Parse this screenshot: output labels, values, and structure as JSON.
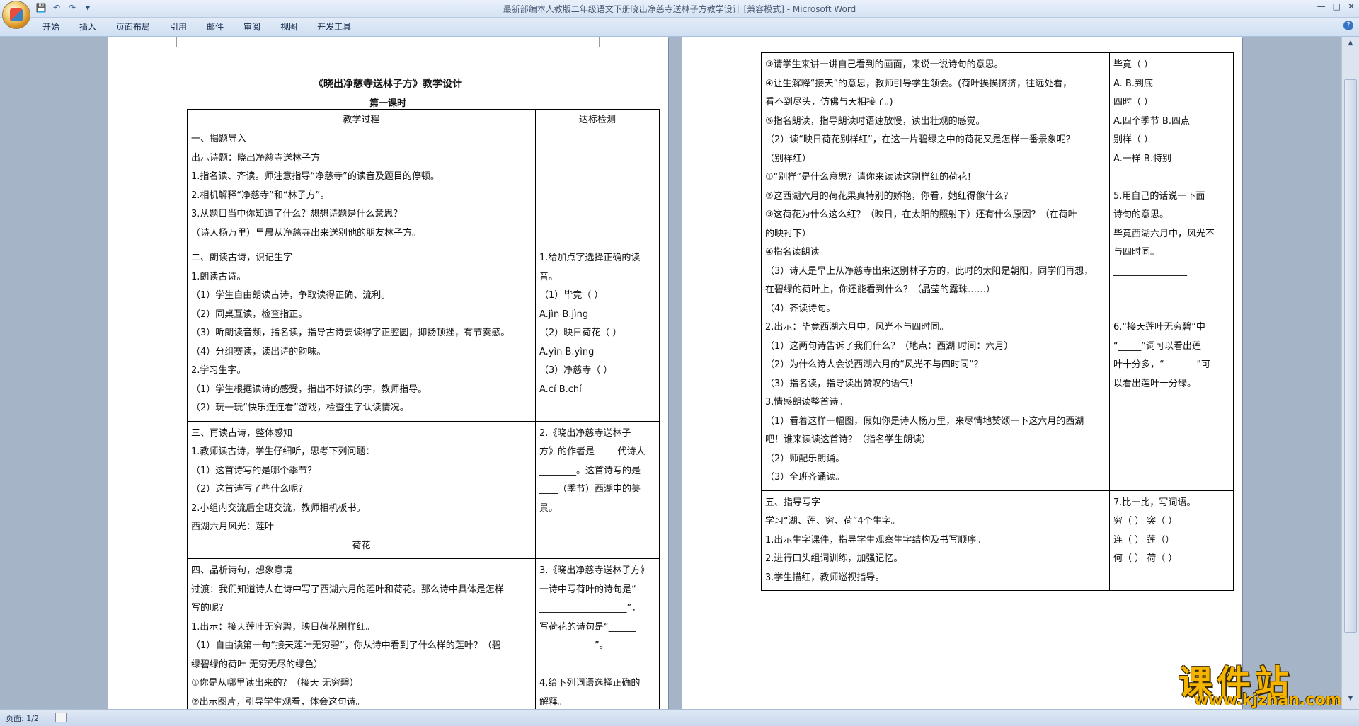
{
  "window": {
    "title": "最新部编本人教版二年级语文下册晓出净慈寺送林子方教学设计 [兼容模式] - Microsoft Word",
    "minimize": "—",
    "maximize": "□",
    "close": "✕"
  },
  "ribbon": {
    "tabs": [
      "开始",
      "插入",
      "页面布局",
      "引用",
      "邮件",
      "审阅",
      "视图",
      "开发工具"
    ],
    "help": "?"
  },
  "document": {
    "title": "《晓出净慈寺送林子方》教学设计",
    "subtitle": "第一课时",
    "table_headers": [
      "教学过程",
      "达标检测"
    ],
    "page1_rows": [
      {
        "left": [
          "一、揭题导入",
          "出示诗题：晓出净慈寺送林子方",
          "1.指名读、齐读。师注意指导“净慈寺”的读音及题目的停顿。",
          "2.相机解释“净慈寺”和“林子方”。",
          "3.从题目当中你知道了什么？想想诗题是什么意思？",
          "（诗人杨万里）早晨从净慈寺出来送别他的朋友林子方。"
        ],
        "right": [
          ""
        ]
      },
      {
        "left": [
          "二、朗读古诗，识记生字",
          "1.朗读古诗。",
          "（1）学生自由朗读古诗，争取读得正确、流利。",
          "（2）同桌互读，检查指正。",
          "（3）听朗读音频，指名读，指导古诗要读得字正腔圆，抑扬顿挫，有节奏感。",
          "（4）分组赛读，读出诗的韵味。",
          "2.学习生字。",
          "（1）学生根据读诗的感受，指出不好读的字，教师指导。",
          "（2）玩一玩“快乐连连看”游戏，检查生字认读情况。"
        ],
        "right": [
          "1.给加点字选择正确的读",
          "音。",
          "（1）毕竟（ ）",
          "A.jìn  B.jìng",
          "（2）映日荷花（ ）",
          "A.yìn  B.yìng",
          "（3）净慈寺（ ）",
          "A.cí  B.chí"
        ]
      },
      {
        "left": [
          "三、再读古诗，整体感知",
          "1.教师读古诗，学生仔细听，思考下列问题：",
          "（1）这首诗写的是哪个季节？",
          "（2）这首诗写了些什么呢?",
          "2.小组内交流后全班交流，教师相机板书。",
          "   西湖六月风光：莲叶",
          "荷花"
        ],
        "right": [
          "2.《晓出净慈寺送林子",
          "方》的作者是_____代诗人",
          "________。这首诗写的是",
          "____（季节）西湖中的美",
          "景。",
          ""
        ]
      },
      {
        "left": [
          "四、品析诗句，想象意境",
          "过渡：我们知道诗人在诗中写了西湖六月的莲叶和荷花。那么诗中具体是怎样",
          "写的呢？",
          "1.出示：接天莲叶无穷碧，映日荷花别样红。",
          "（1）自由读第一句“接天莲叶无穷碧”，你从诗中看到了什么样的莲叶？（碧",
          "绿碧绿的荷叶    无穷无尽的绿色）",
          "①你是从哪里读出来的？（接天    无穷碧）",
          "②出示图片，引导学生观看，体会这句诗。"
        ],
        "right": [
          "3.《晓出净慈寺送林子方》",
          "一诗中写荷叶的诗句是“_",
          "___________________”，",
          "写荷花的诗句是“______",
          "____________”。",
          "",
          "4.给下列词语选择正确的",
          "解释。"
        ]
      }
    ],
    "page2_rows": [
      {
        "left": [
          "③请学生来讲一讲自己看到的画面，来说一说诗句的意思。",
          "④让生解释“接天”的意思，教师引导学生领会。(荷叶挨挨挤挤，往远处看，",
          "看不到尽头，仿佛与天相接了。)",
          "⑤指名朗读，指导朗读时语速放慢，读出壮观的感觉。",
          "（2）读“映日荷花别样红”，在这一片碧绿之中的荷花又是怎样一番景象呢？",
          "（别样红）",
          "①“别样”是什么意思？请你来读读这别样红的荷花！",
          "②这西湖六月的荷花果真特别的娇艳，你看，她红得像什么？",
          "③这荷花为什么这么红？（映日，在太阳的照射下）还有什么原因？（在荷叶",
          "的映衬下）",
          "   ④指名读朗读。",
          "（3）诗人是早上从净慈寺出来送别林子方的，此时的太阳是朝阳，同学们再想，",
          "在碧绿的荷叶上，你还能看到什么？（晶莹的露珠……）",
          "（4）齐读诗句。",
          "2.出示：毕竟西湖六月中，风光不与四时同。",
          "（1）这两句诗告诉了我们什么？（地点：西湖    时间：六月）",
          "（2）为什么诗人会说西湖六月的“风光不与四时同”？",
          "（3）指名读，指导读出赞叹的语气！",
          "3.情感朗读整首诗。",
          "（1）看着这样一幅图，假如你是诗人杨万里，来尽情地赞颂一下这六月的西湖",
          "吧！谁来读读这首诗？（指名学生朗读）",
          "（2）师配乐朗诵。",
          "（3）全班齐诵读。"
        ],
        "right": [
          "毕竟（ ）",
          "A.     B.到底",
          "四时（ ）",
          "A.四个季节   B.四点",
          "别样（ ）",
          "A.一样    B.特别",
          "",
          "5.用自己的话说一下面",
          "诗句的意思。",
          "毕竟西湖六月中，风光不",
          "与四时同。",
          "________________",
          "________________",
          "",
          "6.“接天莲叶无穷碧”中",
          "“_____”词可以看出莲",
          "叶十分多，“_______”可",
          "以看出莲叶十分绿。",
          "",
          "",
          "",
          "",
          ""
        ]
      },
      {
        "left": [
          "五、指导写字",
          "学习“湖、莲、穷、荷”4个生字。",
          "1.出示生字课件，指导学生观察生字结构及书写顺序。",
          "2.进行口头组词训练，加强记忆。",
          "3.学生描红，教师巡视指导。"
        ],
        "right": [
          "7.比一比，写词语。",
          "穷（   ）     突（  ）",
          "连（   ）     莲（）",
          "何（   ）     荷（ ）"
        ]
      }
    ]
  },
  "status": {
    "page": "页面: 1/2"
  },
  "watermark": {
    "text": "课件站",
    "url": "www.kjzhan.com"
  }
}
